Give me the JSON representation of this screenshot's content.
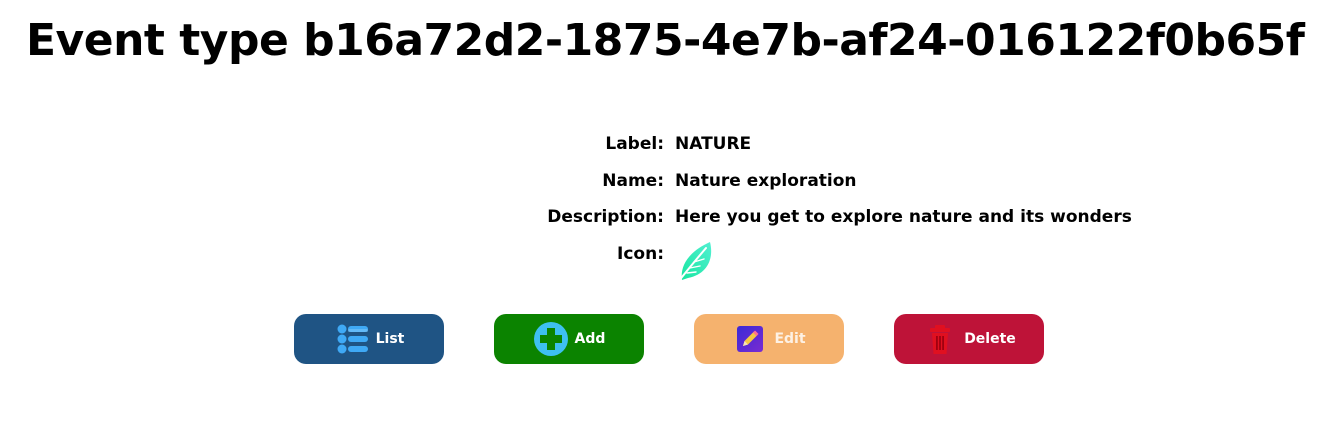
{
  "page": {
    "title": "Event type b16a72d2-1875-4e7b-af24-016122f0b65f"
  },
  "details": {
    "label": {
      "key": "Label:",
      "value": "NATURE"
    },
    "name": {
      "key": "Name:",
      "value": "Nature exploration"
    },
    "description": {
      "key": "Description:",
      "value": "Here you get to explore nature and its wonders"
    },
    "icon": {
      "key": "Icon:",
      "icon_name": "leaf-icon",
      "color": "#2ee6b0"
    }
  },
  "actions": {
    "list": {
      "label": "List",
      "icon_name": "list-icon",
      "color": "#1f5484"
    },
    "add": {
      "label": "Add",
      "icon_name": "plus-circle-icon",
      "color": "#0b8300"
    },
    "edit": {
      "label": "Edit",
      "icon_name": "pencil-icon",
      "color": "#f5b26e"
    },
    "delete": {
      "label": "Delete",
      "icon_name": "trash-icon",
      "color": "#be1338"
    }
  }
}
